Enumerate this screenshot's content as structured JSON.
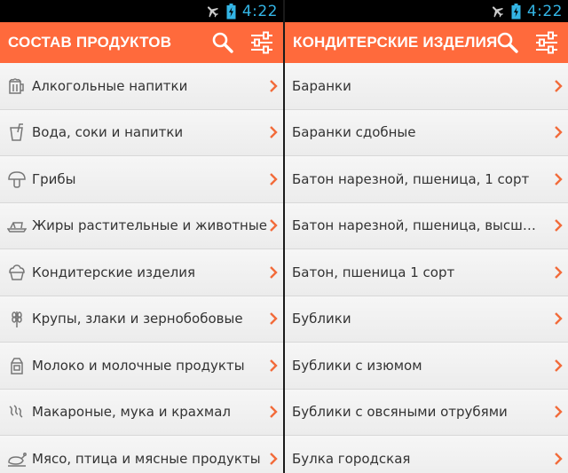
{
  "status_bar": {
    "time": "4:22",
    "time_color": "#33b5e5"
  },
  "accent_color": "#ff6a3c",
  "left_screen": {
    "title": "СОСТАВ ПРОДУКТОВ",
    "actions": [
      "search-icon",
      "filter-sliders-icon"
    ],
    "items": [
      {
        "icon": "beer-mug-icon",
        "label": "Алкогольные напитки"
      },
      {
        "icon": "glass-straw-icon",
        "label": "Вода, соки и напитки"
      },
      {
        "icon": "mushroom-icon",
        "label": "Грибы"
      },
      {
        "icon": "butter-icon",
        "label": "Жиры растительные и животные"
      },
      {
        "icon": "cupcake-icon",
        "label": "Кондитерские изделия"
      },
      {
        "icon": "wheat-icon",
        "label": "Крупы, злаки и зернобобовые"
      },
      {
        "icon": "milk-carton-icon",
        "label": "Молоко и молочные продукты"
      },
      {
        "icon": "pasta-icon",
        "label": "Макароные, мука и крахмал"
      },
      {
        "icon": "roast-chicken-icon",
        "label": "Мясо, птица и мясные продукты"
      }
    ]
  },
  "right_screen": {
    "title": "КОНДИТЕРСКИЕ ИЗДЕЛИЯ",
    "actions": [
      "search-icon",
      "filter-sliders-icon"
    ],
    "items": [
      {
        "label": "Баранки"
      },
      {
        "label": "Баранки сдобные"
      },
      {
        "label": "Батон нарезной, пшеница, 1 сорт"
      },
      {
        "label": "Батон нарезной, пшеница, высший сорт"
      },
      {
        "label": "Батон, пшеница 1 сорт"
      },
      {
        "label": "Бублики"
      },
      {
        "label": "Бублики с изюмом"
      },
      {
        "label": "Бублики с овсяными отрубями"
      },
      {
        "label": "Булка городская"
      }
    ]
  }
}
